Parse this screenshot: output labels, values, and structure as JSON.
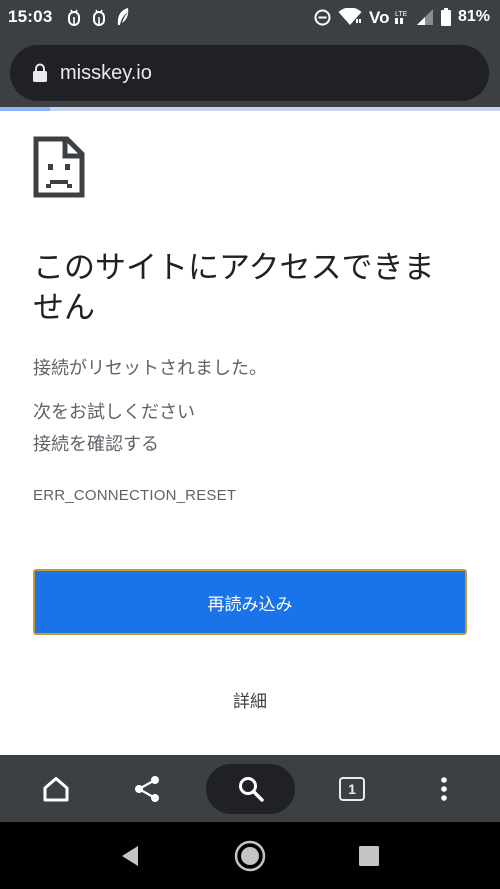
{
  "status_bar": {
    "time": "15:03",
    "battery": "81%",
    "icons_left": [
      "usb-debug-icon",
      "usb-debug-icon",
      "feather-icon"
    ],
    "icons_right": [
      "dnd-icon",
      "wifi-icon",
      "volte-icon",
      "signal-icon",
      "battery-icon"
    ]
  },
  "browser": {
    "url": "misskey.io",
    "load_progress": 0.1,
    "open_tab_count": "1"
  },
  "error_page": {
    "heading": "このサイトにアクセスできません",
    "message": "接続がリセットされました。",
    "suggestion_title": "次をお試しください",
    "suggestion_item": "接続を確認する",
    "error_code": "ERR_CONNECTION_RESET",
    "reload_label": "再読み込み",
    "details_label": "詳細"
  },
  "colors": {
    "toolbar": "#3c4043",
    "primary_button": "#1a73e8",
    "text_secondary": "#5f6368"
  }
}
